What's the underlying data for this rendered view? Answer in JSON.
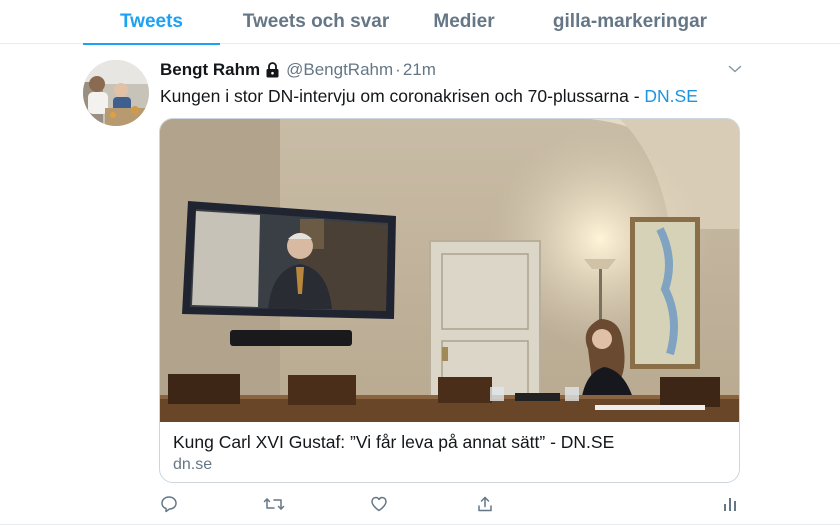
{
  "tabs": [
    {
      "label": "Tweets",
      "active": true
    },
    {
      "label": "Tweets och svar",
      "active": false
    },
    {
      "label": "Medier",
      "active": false
    },
    {
      "label": "gilla-markeringar",
      "active": false
    }
  ],
  "tweet": {
    "author_name": "Bengt Rahm",
    "protected_icon": "lock-icon",
    "handle": "@BengtRahm",
    "separator": "·",
    "time": "21m",
    "text_main": "Kungen i stor DN-intervju om coronakrisen och 70-plussarna - ",
    "text_link": "DN.SE",
    "card": {
      "title": "Kung Carl XVI Gustaf: ”Vi får leva på annat sätt” - DN.SE",
      "domain": "dn.se"
    },
    "actions": [
      "reply-icon",
      "retweet-icon",
      "like-icon",
      "share-icon",
      "analytics-icon"
    ]
  },
  "colors": {
    "accent": "#1da1f2",
    "link": "#1b95e0",
    "secondary_text": "#657786",
    "border": "#ccd6dd"
  }
}
